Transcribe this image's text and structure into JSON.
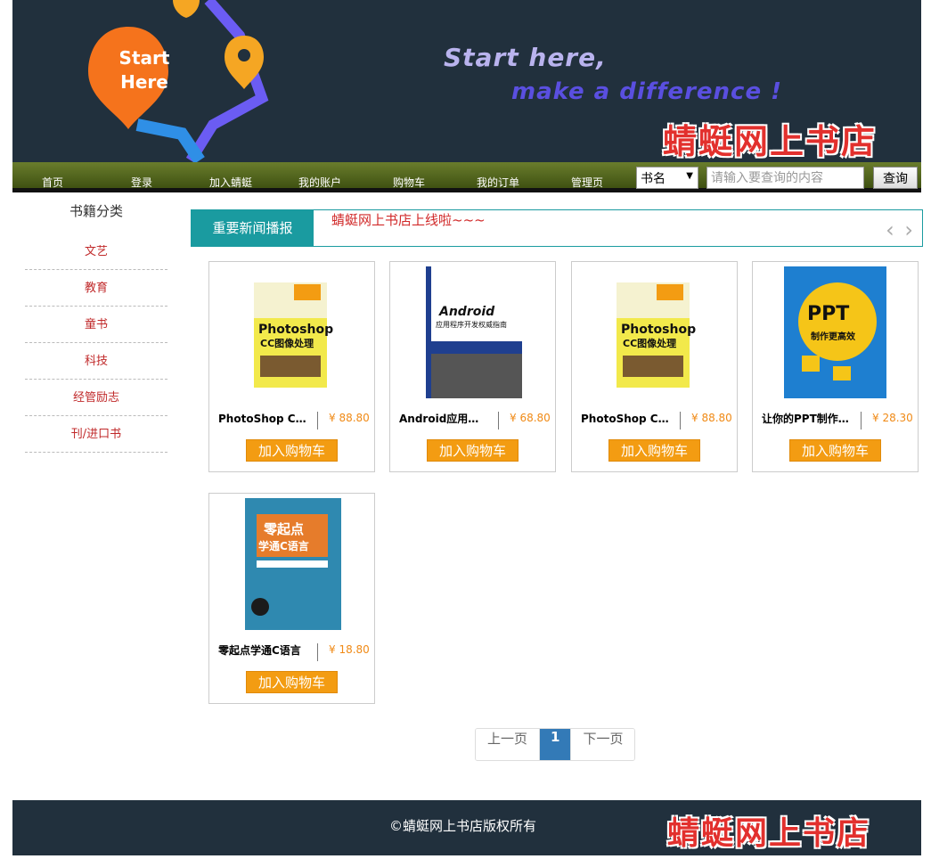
{
  "header": {
    "logo_text": "Start Here",
    "slogan_line1": "Start here,",
    "slogan_line2": "make a difference !",
    "store_name": "蜻蜓网上书店"
  },
  "nav": {
    "items": [
      "首页",
      "登录",
      "加入蜻蜓",
      "我的账户",
      "购物车",
      "我的订单",
      "管理页"
    ],
    "search_type": "书名",
    "search_placeholder": "请输入要查询的内容",
    "search_button": "查询"
  },
  "sidebar": {
    "title": "书籍分类",
    "items": [
      "文艺",
      "教育",
      "童书",
      "科技",
      "经管励志",
      "刊/进口书"
    ]
  },
  "news": {
    "label": "重要新闻播报",
    "text": "蜻蜓网上书店上线啦~~~",
    "prev": "‹",
    "next": "›"
  },
  "products": [
    {
      "name": "PhotoShop CC图像处理",
      "price": "¥ 88.80",
      "button": "加入购物车",
      "cover": "photoshop"
    },
    {
      "name": "Android应用程序开发权威指南",
      "price": "¥ 68.80",
      "button": "加入购物车",
      "cover": "android"
    },
    {
      "name": "PhotoShop CC图像处理",
      "price": "¥ 88.80",
      "button": "加入购物车",
      "cover": "photoshop"
    },
    {
      "name": "让你的PPT制作更高效",
      "price": "¥ 28.30",
      "button": "加入购物车",
      "cover": "ppt"
    },
    {
      "name": "零起点学通C语言",
      "price": "¥ 18.80",
      "button": "加入购物车",
      "cover": "clang"
    }
  ],
  "pagination": {
    "prev": "上一页",
    "current": "1",
    "next": "下一页"
  },
  "footer": {
    "copyright": "©蜻蜓网上书店版权所有",
    "store_name": "蜻蜓网上书店"
  },
  "colors": {
    "accent": "#1a9ba0",
    "nav_green": "#4e6220",
    "button_orange": "#f39c12",
    "price_orange": "#f08a16",
    "category_red": "#c0292a"
  }
}
